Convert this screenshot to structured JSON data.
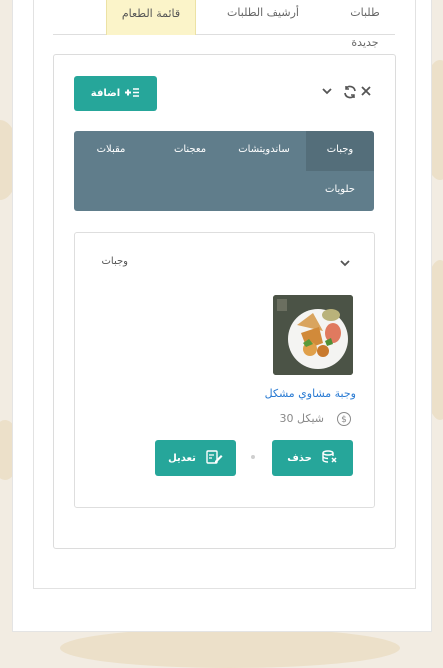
{
  "tabs": [
    {
      "label": "طلبات جديدة",
      "active": false
    },
    {
      "label": "أرشيف الطلبات",
      "active": false
    },
    {
      "label": "قائمة الطعام",
      "active": true
    }
  ],
  "toolbar": {
    "add_label": "اضافة",
    "add_icon": "add-list-icon",
    "close_icon": "close-icon",
    "refresh_icon": "refresh-icon",
    "collapse_icon": "chevron-down-icon"
  },
  "categories": [
    {
      "label": "وجبات",
      "active": true
    },
    {
      "label": "ساندويتشات",
      "active": false
    },
    {
      "label": "معجنات",
      "active": false
    },
    {
      "label": "مقبلات",
      "active": false
    },
    {
      "label": "حلويات",
      "active": false
    }
  ],
  "section": {
    "title": "وجبات",
    "items": [
      {
        "name": "وجبة مشاوي مشكل",
        "price": "30 شيكل",
        "delete_label": "حذف",
        "edit_label": "تعديل"
      }
    ]
  },
  "colors": {
    "accent": "#26a69a",
    "category_bg": "#607d8b",
    "active_tab": "#fbf4c9",
    "link": "#2a7bd3"
  }
}
